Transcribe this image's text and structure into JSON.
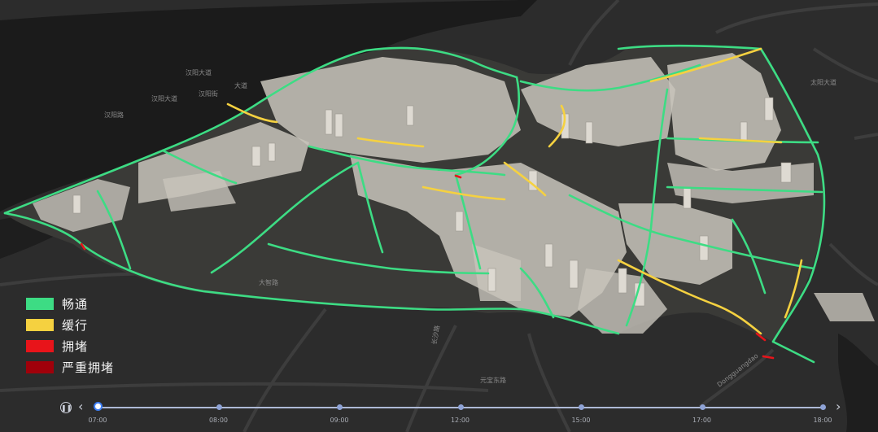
{
  "map": {
    "background": "#2c2c2c",
    "water_color": "#1a1a1a",
    "building_color": "#c9c5bd",
    "road_labels": [
      "汉阳大道",
      "汉阳大道",
      "大道",
      "汉阳街",
      "汉阳路",
      "大智路",
      "元宝东路",
      "长沙路",
      "Dongguangdao",
      "太阳大道"
    ]
  },
  "legend": {
    "items": [
      {
        "label": "畅通",
        "color": "#3ddc84"
      },
      {
        "label": "缓行",
        "color": "#f5d140"
      },
      {
        "label": "拥堵",
        "color": "#e8141a"
      },
      {
        "label": "严重拥堵",
        "color": "#a0000a"
      }
    ]
  },
  "timeline": {
    "play_icon": "pause-icon",
    "prev_icon": "chevron-left-icon",
    "next_icon": "chevron-right-icon",
    "ticks": [
      "07:00",
      "08:00",
      "09:00",
      "12:00",
      "15:00",
      "17:00",
      "18:00"
    ],
    "active_index": 0
  }
}
